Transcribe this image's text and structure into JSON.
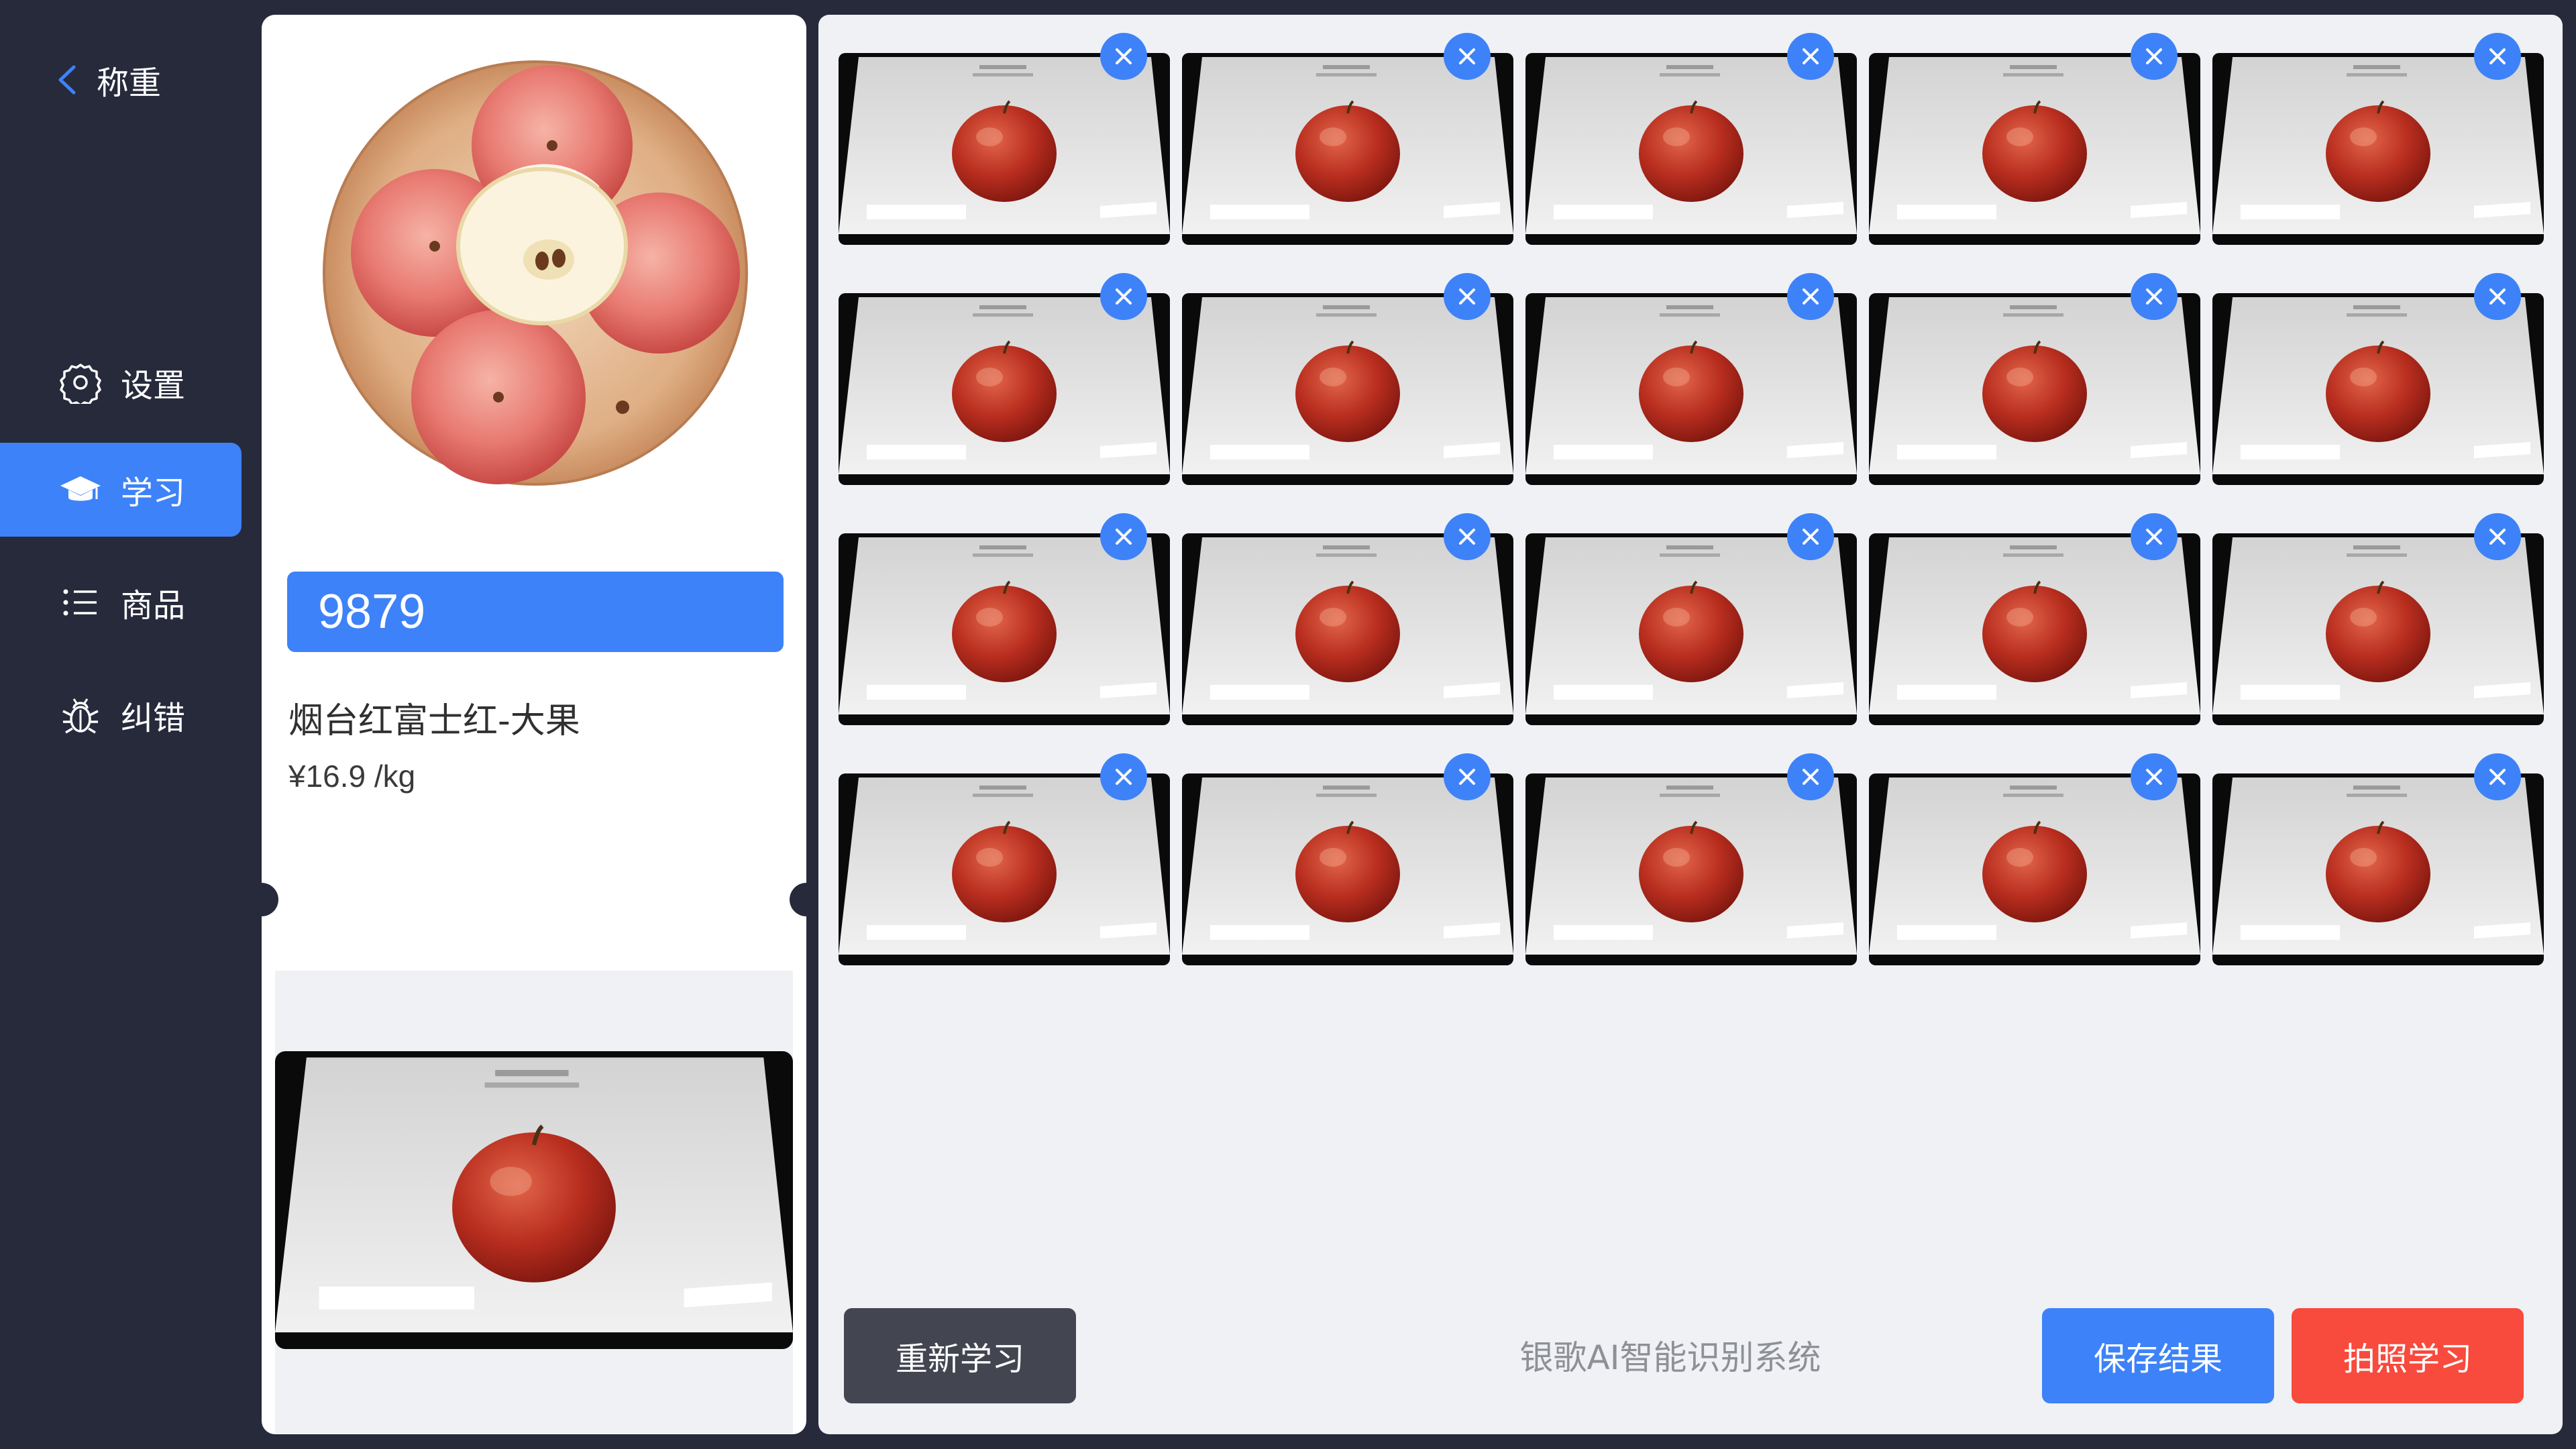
{
  "header": {
    "back_label": "称重"
  },
  "sidebar": {
    "items": [
      {
        "label": "设置",
        "icon": "gear-icon",
        "active": false
      },
      {
        "label": "学习",
        "icon": "graduation-cap-icon",
        "active": true
      },
      {
        "label": "商品",
        "icon": "list-icon",
        "active": false
      },
      {
        "label": "纠错",
        "icon": "bug-icon",
        "active": false
      }
    ]
  },
  "product": {
    "plu": "9879",
    "name": "烟台红富士红-大果",
    "price": "¥16.9 /kg"
  },
  "gallery": {
    "rows": 4,
    "columns": 5,
    "count": 20
  },
  "actions": {
    "relearn_label": "重新学习",
    "save_label": "保存结果",
    "photo_learn_label": "拍照学习"
  },
  "brand_text": "银歌AI智能识别系统",
  "colors": {
    "background": "#272a3b",
    "accent": "#3d82f8",
    "danger": "#f84a3d",
    "dark_button": "#434551"
  }
}
